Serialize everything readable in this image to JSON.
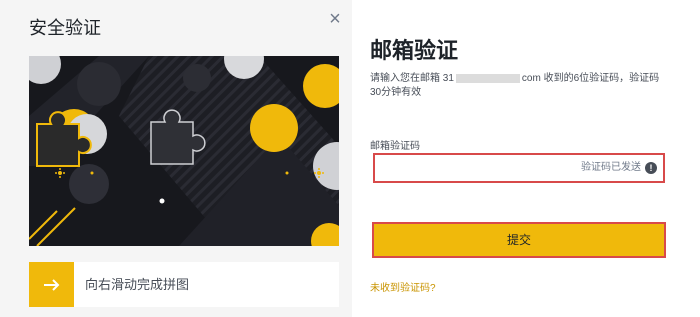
{
  "captcha": {
    "title": "安全验证",
    "close_icon": "close-icon",
    "slider_label": "向右滑动完成拼图",
    "slider_icon": "arrow-right-icon",
    "accent_color": "#f0b90b"
  },
  "verify": {
    "title": "邮箱验证",
    "desc_prefix": "请输入您在邮箱 31",
    "desc_suffix": "com 收到的6位验证码，验证码30分钟有效",
    "field_label": "邮箱验证码",
    "code_value": "",
    "code_sent": "验证码已发送",
    "info_icon": "info-icon",
    "submit_label": "提交",
    "no_code_link": "未收到验证码?",
    "error_border_color": "#d84a4a"
  }
}
